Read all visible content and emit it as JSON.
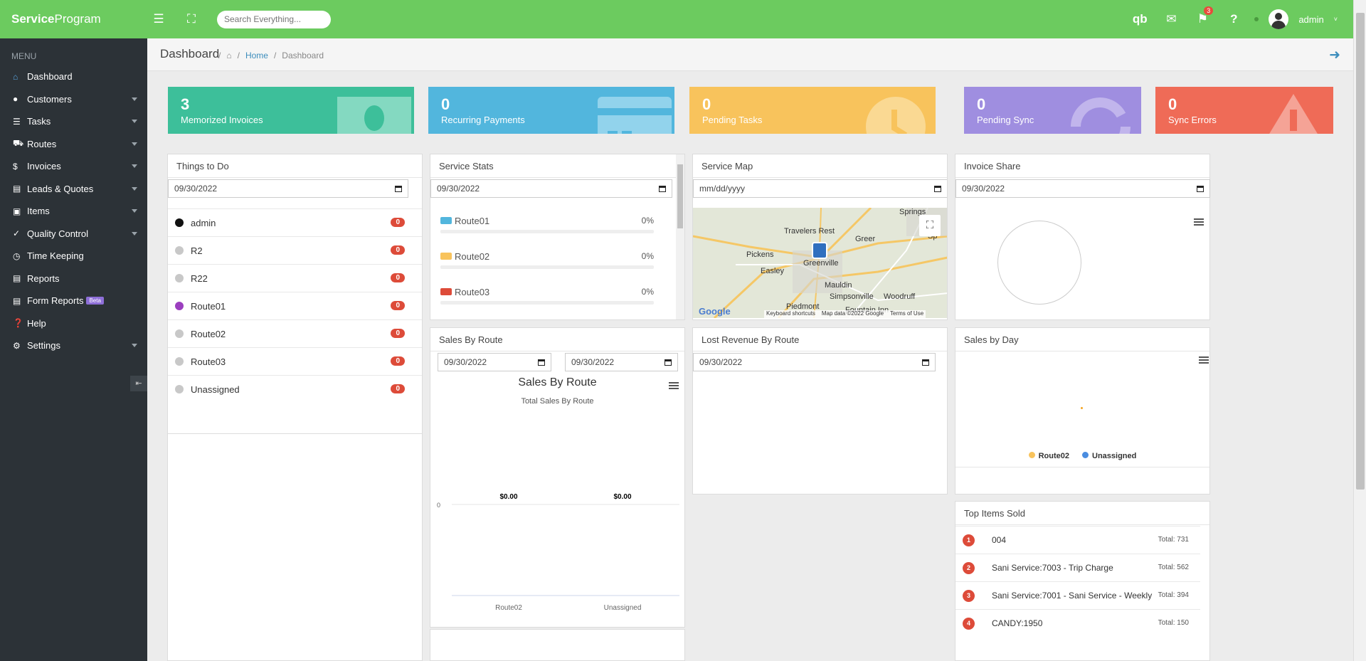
{
  "brand": {
    "bold": "Service",
    "rest": "Program"
  },
  "search": {
    "placeholder": "Search Everything..."
  },
  "header": {
    "notification_count": "3",
    "user": "admin"
  },
  "sidebar": {
    "menu_label": "MENU",
    "items": [
      {
        "label": "Dashboard"
      },
      {
        "label": "Customers"
      },
      {
        "label": "Tasks"
      },
      {
        "label": "Routes"
      },
      {
        "label": "Invoices"
      },
      {
        "label": "Leads & Quotes"
      },
      {
        "label": "Items"
      },
      {
        "label": "Quality Control"
      },
      {
        "label": "Time Keeping"
      },
      {
        "label": "Reports"
      },
      {
        "label": "Form Reports",
        "badge": "Beta"
      },
      {
        "label": "Help"
      },
      {
        "label": "Settings"
      }
    ]
  },
  "breadcrumb": {
    "title": "Dashboard",
    "home": "Home",
    "current": "Dashboard"
  },
  "tiles": [
    {
      "value": "3",
      "label": "Memorized Invoices",
      "color": "#3dbf9a"
    },
    {
      "value": "0",
      "label": "Recurring Payments",
      "color": "#52b6dd"
    },
    {
      "value": "0",
      "label": "Pending Tasks",
      "color": "#f8c35c"
    },
    {
      "value": "0",
      "label": "Pending Sync",
      "color": "#9f8ee0"
    },
    {
      "value": "0",
      "label": "Sync Errors",
      "color": "#ef6b57"
    }
  ],
  "todo": {
    "title": "Things to Do",
    "date": "09/30/2022",
    "rows": [
      {
        "label": "admin",
        "count": "0",
        "color": "#111111"
      },
      {
        "label": "R2",
        "count": "0",
        "color": "#c8c8c8"
      },
      {
        "label": "R22",
        "count": "0",
        "color": "#c8c8c8"
      },
      {
        "label": "Route01",
        "count": "0",
        "color": "#9b3fbf"
      },
      {
        "label": "Route02",
        "count": "0",
        "color": "#c8c8c8"
      },
      {
        "label": "Route03",
        "count": "0",
        "color": "#c8c8c8"
      },
      {
        "label": "Unassigned",
        "count": "0",
        "color": "#c8c8c8"
      }
    ]
  },
  "service_stats": {
    "title": "Service Stats",
    "date": "09/30/2022",
    "rows": [
      {
        "label": "Route01",
        "pct": "0%",
        "color": "#52b6dd"
      },
      {
        "label": "Route02",
        "pct": "0%",
        "color": "#f8c35c"
      },
      {
        "label": "Route03",
        "pct": "0%",
        "color": "#dd4b39"
      }
    ]
  },
  "service_map": {
    "title": "Service Map",
    "date": "mm/dd/yyyy",
    "places": [
      "Travelers Rest",
      "Greer",
      "Pickens",
      "Easley",
      "Greenville",
      "Mauldin",
      "Simpsonville",
      "Woodruff",
      "Piedmont",
      "Fountain Inn",
      "Springs",
      "Sp"
    ],
    "google": "Google",
    "shortcuts": "Keyboard shortcuts",
    "mapdata": "Map data ©2022 Google",
    "terms": "Terms of Use"
  },
  "invoice_share": {
    "title": "Invoice Share",
    "date": "09/30/2022"
  },
  "sales_by_route": {
    "title": "Sales By Route",
    "date_from": "09/30/2022",
    "date_to": "09/30/2022",
    "chart_title": "Sales By Route",
    "chart_subtitle": "Total Sales By Route"
  },
  "lost_revenue": {
    "title": "Lost Revenue By Route",
    "date": "09/30/2022"
  },
  "sales_by_day": {
    "title": "Sales by Day",
    "legend": [
      {
        "label": "Route02",
        "color": "#f8c35c"
      },
      {
        "label": "Unassigned",
        "color": "#4a8de0"
      }
    ]
  },
  "top_items": {
    "title": "Top Items Sold",
    "rows": [
      {
        "rank": "1",
        "name": "004",
        "total": "Total: 731"
      },
      {
        "rank": "2",
        "name": "Sani Service:7003 - Trip Charge",
        "total": "Total: 562"
      },
      {
        "rank": "3",
        "name": "Sani Service:7001 - Sani Service - Weekly",
        "total": "Total: 394"
      },
      {
        "rank": "4",
        "name": "CANDY:1950",
        "total": "Total: 150"
      }
    ]
  },
  "chart_data": {
    "type": "bar",
    "title": "Sales By Route",
    "subtitle": "Total Sales By Route",
    "categories": [
      "Route02",
      "Unassigned"
    ],
    "values": [
      0,
      0
    ],
    "data_labels": [
      "$0.00",
      "$0.00"
    ],
    "y_ticks": [
      "0"
    ],
    "xlabel": "",
    "ylabel": ""
  }
}
